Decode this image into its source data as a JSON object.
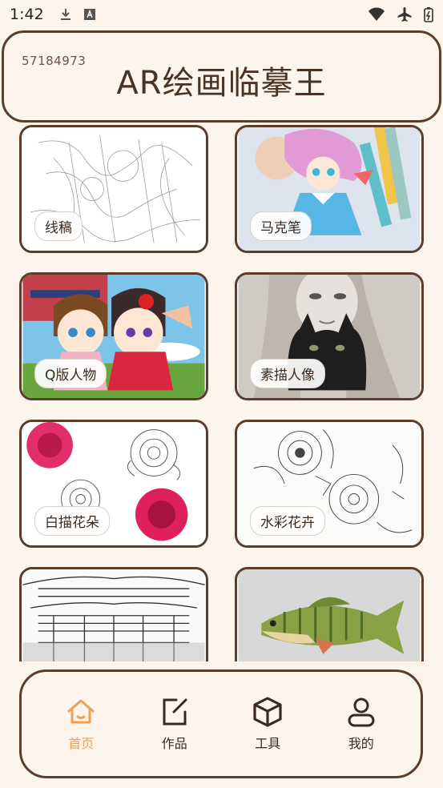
{
  "status_bar": {
    "time": "1:42",
    "left_icons": [
      "download-icon",
      "a-box-icon"
    ],
    "right_icons": [
      "wifi-icon",
      "airplane-icon",
      "battery-icon"
    ]
  },
  "header": {
    "code": "57184973",
    "title": "AR绘画临摹王"
  },
  "categories": [
    {
      "label": "线稿",
      "icon": "line-art"
    },
    {
      "label": "马克笔",
      "icon": "marker"
    },
    {
      "label": "Q版人物",
      "icon": "chibi"
    },
    {
      "label": "素描人像",
      "icon": "sketch-portrait"
    },
    {
      "label": "白描花朵",
      "icon": "line-flower"
    },
    {
      "label": "水彩花卉",
      "icon": "watercolor-flower"
    },
    {
      "label": "",
      "icon": "architecture"
    },
    {
      "label": "",
      "icon": "fish"
    }
  ],
  "nav": {
    "items": [
      {
        "label": "首页",
        "icon": "home-icon",
        "active": true
      },
      {
        "label": "作品",
        "icon": "edit-icon",
        "active": false
      },
      {
        "label": "工具",
        "icon": "cube-icon",
        "active": false
      },
      {
        "label": "我的",
        "icon": "user-icon",
        "active": false
      }
    ]
  },
  "colors": {
    "background": "#fdf5ec",
    "border": "#5a3d2b",
    "active": "#f0a055"
  }
}
